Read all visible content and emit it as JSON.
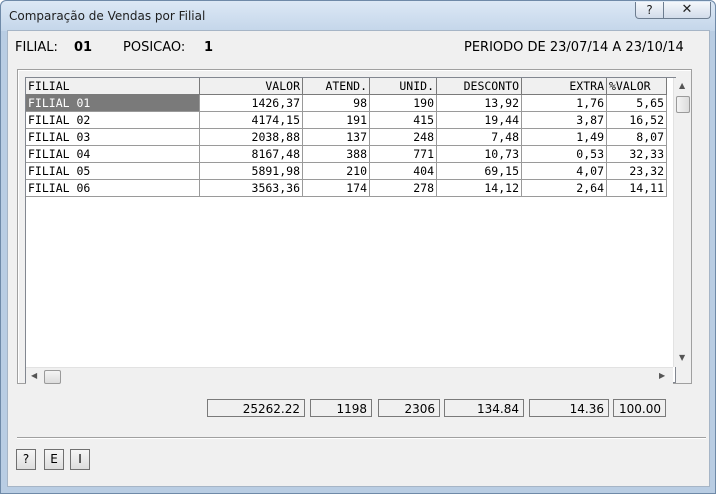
{
  "window": {
    "title": "Comparação de Vendas por Filial",
    "help_label": "?",
    "close_label": "✕"
  },
  "header": {
    "filial_label": "FILIAL:",
    "filial_value": "01",
    "posicao_label": "POSICAO:",
    "posicao_value": "1",
    "periodo": "PERIODO DE 23/07/14 A 23/10/14"
  },
  "grid": {
    "columns": [
      "FILIAL",
      "VALOR",
      "ATEND.",
      "UNID.",
      "DESCONTO",
      "EXTRA",
      "%VALOR"
    ],
    "rows": [
      [
        "FILIAL 01",
        "1426,37",
        "98",
        "190",
        "13,92",
        "1,76",
        "5,65"
      ],
      [
        "FILIAL 02",
        "4174,15",
        "191",
        "415",
        "19,44",
        "3,87",
        "16,52"
      ],
      [
        "FILIAL 03",
        "2038,88",
        "137",
        "248",
        "7,48",
        "1,49",
        "8,07"
      ],
      [
        "FILIAL 04",
        "8167,48",
        "388",
        "771",
        "10,73",
        "0,53",
        "32,33"
      ],
      [
        "FILIAL 05",
        "5891,98",
        "210",
        "404",
        "69,15",
        "4,07",
        "23,32"
      ],
      [
        "FILIAL 06",
        "3563,36",
        "174",
        "278",
        "14,12",
        "2,64",
        "14,11"
      ]
    ],
    "selected_row": 0
  },
  "totals": [
    "25262.22",
    "1198",
    "2306",
    "134.84",
    "14.36",
    "100.00"
  ],
  "buttons": [
    "?",
    "E",
    "I"
  ],
  "icons": {
    "scroll_up": "up-arrow-icon",
    "scroll_down": "down-arrow-icon",
    "scroll_left": "left-arrow-icon",
    "scroll_right": "right-arrow-icon"
  },
  "colors": {
    "selected_row_bg": "#7a7a7a",
    "selected_row_fg": "#ffffff",
    "titlebar": "#c4d6ea"
  }
}
